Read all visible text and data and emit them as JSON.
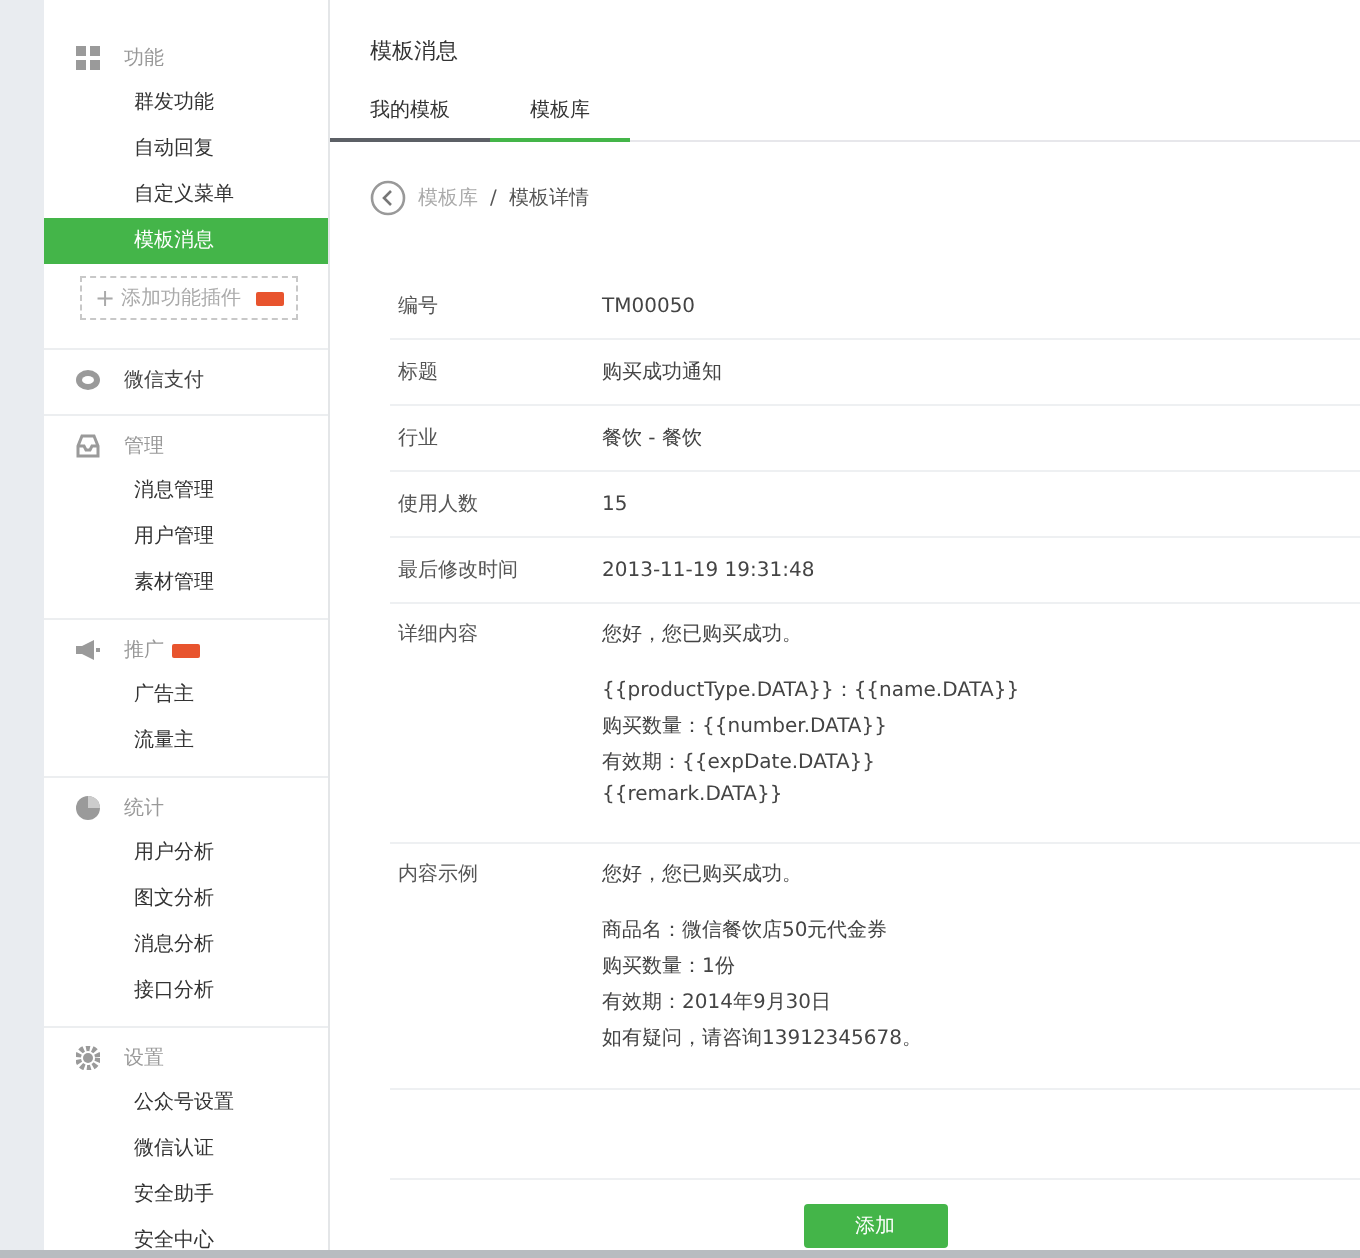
{
  "sidebar": {
    "sections": [
      {
        "title": "功能",
        "items": [
          {
            "label": "群发功能",
            "selected": false
          },
          {
            "label": "自动回复",
            "selected": false
          },
          {
            "label": "自定义菜单",
            "selected": false
          },
          {
            "label": "模板消息",
            "selected": true
          }
        ],
        "add_button": {
          "plus": "+",
          "label": "添加功能插件",
          "badge": true
        }
      },
      {
        "title": "微信支付"
      },
      {
        "title": "管理",
        "items": [
          {
            "label": "消息管理",
            "selected": false
          },
          {
            "label": "用户管理",
            "selected": false
          },
          {
            "label": "素材管理",
            "selected": false
          }
        ]
      },
      {
        "title": "推广",
        "badge": true,
        "items": [
          {
            "label": "广告主",
            "selected": false
          },
          {
            "label": "流量主",
            "selected": false
          }
        ]
      },
      {
        "title": "统计",
        "items": [
          {
            "label": "用户分析",
            "selected": false
          },
          {
            "label": "图文分析",
            "selected": false
          },
          {
            "label": "消息分析",
            "selected": false
          },
          {
            "label": "接口分析",
            "selected": false
          }
        ]
      },
      {
        "title": "设置",
        "items": [
          {
            "label": "公众号设置",
            "selected": false
          },
          {
            "label": "微信认证",
            "selected": false
          },
          {
            "label": "安全助手",
            "selected": false
          },
          {
            "label": "安全中心",
            "selected": false
          }
        ]
      }
    ]
  },
  "page_title": "模板消息",
  "tabs": [
    {
      "label": "我的模板",
      "selected": false
    },
    {
      "label": "模板库",
      "selected": true
    }
  ],
  "breadcrumb": {
    "parent": "模板库",
    "separator": "/",
    "current": "模板详情"
  },
  "details": [
    {
      "label": "编号",
      "paragraphs": [
        [
          "TM00050"
        ]
      ]
    },
    {
      "label": "标题",
      "paragraphs": [
        [
          "购买成功通知"
        ]
      ]
    },
    {
      "label": "行业",
      "paragraphs": [
        [
          "餐饮 - 餐饮"
        ]
      ]
    },
    {
      "label": "使用人数",
      "paragraphs": [
        [
          "15"
        ]
      ]
    },
    {
      "label": "最后修改时间",
      "paragraphs": [
        [
          "2013-11-19 19:31:48"
        ]
      ]
    },
    {
      "label": "详细内容",
      "paragraphs": [
        [
          "您好，您已购买成功。"
        ],
        [
          "{{productType.DATA}}：{{name.DATA}}",
          "购买数量：{{number.DATA}}",
          "有效期：{{expDate.DATA}}",
          "{{remark.DATA}}"
        ]
      ]
    },
    {
      "label": "内容示例",
      "paragraphs": [
        [
          "您好，您已购买成功。"
        ],
        [
          "商品名：微信餐饮店50元代金券",
          "购买数量：1份",
          "有效期：2014年9月30日",
          "如有疑问，请咨询13912345678。"
        ]
      ]
    }
  ],
  "primary_button": "添加"
}
